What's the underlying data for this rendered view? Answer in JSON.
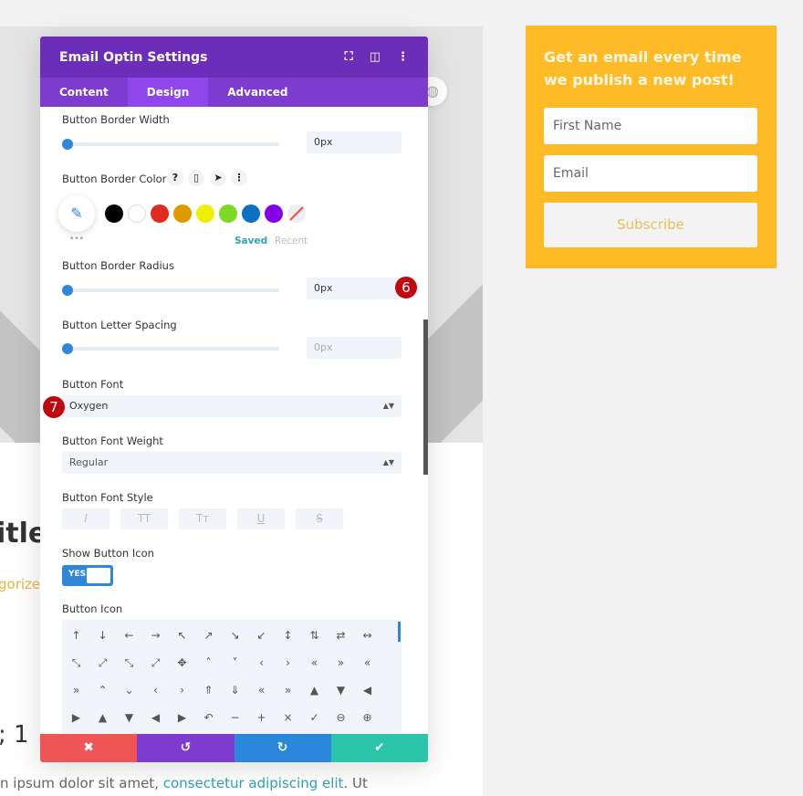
{
  "panel": {
    "title": "Email Optin Settings",
    "tabs": [
      "Content",
      "Design",
      "Advanced"
    ],
    "active_tab": "Design"
  },
  "fields": {
    "border_width": {
      "label": "Button Border Width",
      "value": "0px"
    },
    "border_color": {
      "label": "Button Border Color",
      "swatches": [
        "#000000",
        "#ffffff",
        "#e02b20",
        "#e09900",
        "#edf000",
        "#7cda24",
        "#0c71c3",
        "#8300e9"
      ],
      "saved": "Saved",
      "recent": "Recent",
      "more": "•••"
    },
    "border_radius": {
      "label": "Button Border Radius",
      "value": "0px"
    },
    "letter_spacing": {
      "label": "Button Letter Spacing",
      "value": "0px"
    },
    "font": {
      "label": "Button Font",
      "value": "Oxygen"
    },
    "font_weight": {
      "label": "Button Font Weight",
      "value": "Regular"
    },
    "font_style": {
      "label": "Button Font Style",
      "options": [
        "I",
        "TT",
        "Tт",
        "U",
        "S"
      ]
    },
    "show_icon": {
      "label": "Show Button Icon",
      "value": "YES"
    },
    "icon": {
      "label": "Button Icon",
      "glyphs": [
        "↑",
        "↓",
        "←",
        "→",
        "↖",
        "↗",
        "↘",
        "↙",
        "↕",
        "⇅",
        "⇄",
        "↔",
        "⤡",
        "⤢",
        "⤡",
        "⤢",
        "✥",
        "˄",
        "˅",
        "‹",
        "›",
        "«",
        "»",
        "«",
        "»",
        "⌃",
        "⌄",
        "‹",
        "›",
        "⇑",
        "⇓",
        "«",
        "»",
        "▲",
        "▼",
        "◀",
        "▶",
        "▲",
        "▼",
        "◀",
        "▶",
        "↶",
        "−",
        "+",
        "×",
        "✓",
        "⊖",
        "⊕"
      ]
    }
  },
  "footer": {
    "cancel": "✖",
    "undo": "↺",
    "redo": "↻",
    "save": "✔"
  },
  "colors": {
    "header": "#6c2eb9",
    "tabs": "#7e3bd0",
    "cancel": "#ef5555",
    "undo": "#7e3bd0",
    "redo": "#2b87da",
    "save": "#29c4a9",
    "optin_bg": "#fdbc27"
  },
  "badges": {
    "six": "6",
    "seven": "7"
  },
  "optin": {
    "heading": "Get an email every time we publish a new post!",
    "first_name_placeholder": "First Name",
    "email_placeholder": "Email",
    "subscribe": "Subscribe"
  },
  "page": {
    "title_fragment": "itle",
    "category_fragment": "gorized",
    "heading_fragment": "; 1",
    "text_prefix": "n ipsum dolor sit amet, ",
    "text_link": "consectetur adipiscing elit",
    "text_suffix": ". Ut"
  }
}
